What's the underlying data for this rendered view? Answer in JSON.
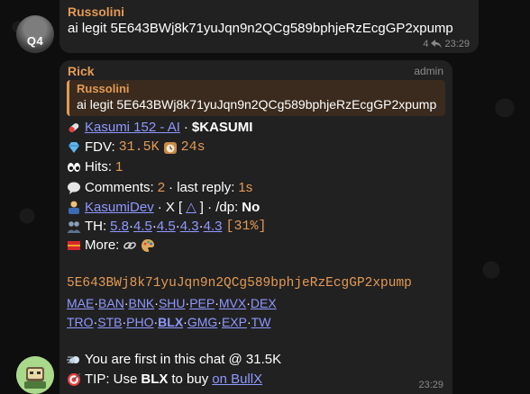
{
  "messages": [
    {
      "sender": "Russolini",
      "avatar_text": "Q4",
      "text": "ai legit 5E643BWj8k71yuJqn9n2QCg589bphjeRzEcgGP2xpump",
      "replies": "4",
      "time": "23:29"
    },
    {
      "sender": "Rick",
      "role": "admin",
      "quote": {
        "sender": "Russolini",
        "text": "ai legit 5E643BWj8k71yuJqn9n2QCg589bphjeRzEcgGP2xpump"
      },
      "token_link": "Kasumi 152 - AI",
      "token_sep": " · ",
      "ticker": "$KASUMI",
      "fdv_label": "FDV:",
      "fdv_value": "31.5K",
      "fdv_age": "24s",
      "hits_label": "Hits:",
      "hits_value": "1",
      "comments_label": "Comments:",
      "comments_value": "2",
      "last_reply_label": " · last reply:",
      "last_reply_value": "1s",
      "dev_link": "KasumiDev",
      "dev_mid": " · X [",
      "dev_glyph": "△",
      "dev_end": "] · /dp:",
      "dev_dp": "No",
      "th_label": "TH:",
      "th_values": [
        "5.8",
        "4.5",
        "4.5",
        "4.3",
        "4.3"
      ],
      "th_total": "[31%]",
      "more_label": "More:",
      "contract": "5E643BWj8k71yuJqn9n2QCg589bphjeRzEcgGP2xpump",
      "dex_row1": [
        "MAE",
        "BAN",
        "BNK",
        "SHU",
        "PEP",
        "MVX",
        "DEX"
      ],
      "dex_row2": [
        "TRO",
        "STB",
        "PHO",
        "BLX",
        "GMG",
        "EXP",
        "TW"
      ],
      "first_text": "You are first in this chat @ 31.5K",
      "tip_prefix": "TIP: Use",
      "tip_bold": "BLX",
      "tip_mid": "to buy",
      "tip_link": "on BullX",
      "time": "23:29"
    }
  ],
  "colors": {
    "sender": "#e39a54",
    "link": "#8f98ff",
    "bubble": "#212121",
    "background": "#0e0e0e"
  },
  "icons": [
    "pill-emoji",
    "gem-emoji",
    "clock-emoji",
    "eyes-emoji",
    "speech-bubble-emoji",
    "developer-emoji",
    "people-emoji",
    "flag-emoji",
    "link-emoji",
    "palette-emoji",
    "dash-emoji",
    "target-emoji",
    "reply-icon"
  ]
}
